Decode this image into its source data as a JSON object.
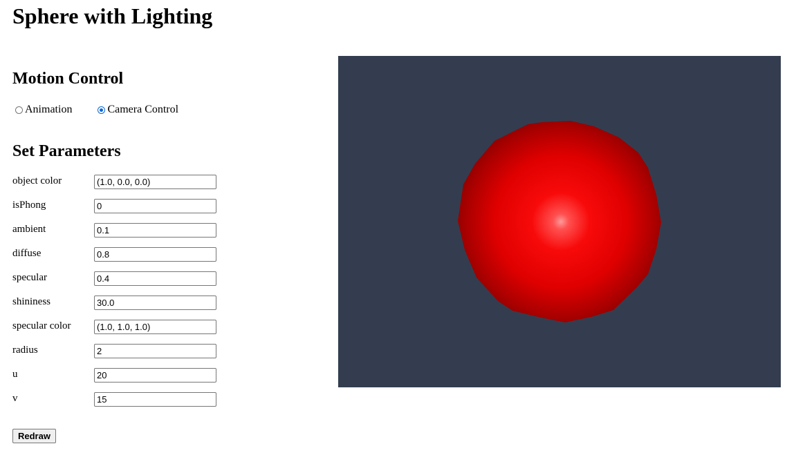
{
  "page": {
    "title": "Sphere with Lighting"
  },
  "motion": {
    "heading": "Motion Control",
    "options": [
      {
        "label": "Animation",
        "checked": false
      },
      {
        "label": "Camera Control",
        "checked": true
      }
    ]
  },
  "params": {
    "heading": "Set Parameters",
    "fields": [
      {
        "label": "object color",
        "value": "(1.0, 0.0, 0.0)"
      },
      {
        "label": "isPhong",
        "value": "0"
      },
      {
        "label": "ambient",
        "value": "0.1"
      },
      {
        "label": "diffuse",
        "value": "0.8"
      },
      {
        "label": "specular",
        "value": "0.4"
      },
      {
        "label": "shininess",
        "value": "30.0"
      },
      {
        "label": "specular color",
        "value": "(1.0, 1.0, 1.0)"
      },
      {
        "label": "radius",
        "value": "2"
      },
      {
        "label": "u",
        "value": "20"
      },
      {
        "label": "v",
        "value": "15"
      }
    ],
    "redraw_label": "Redraw"
  },
  "canvas": {
    "background_color": "#333d4f",
    "object_color": "#ff0000"
  }
}
